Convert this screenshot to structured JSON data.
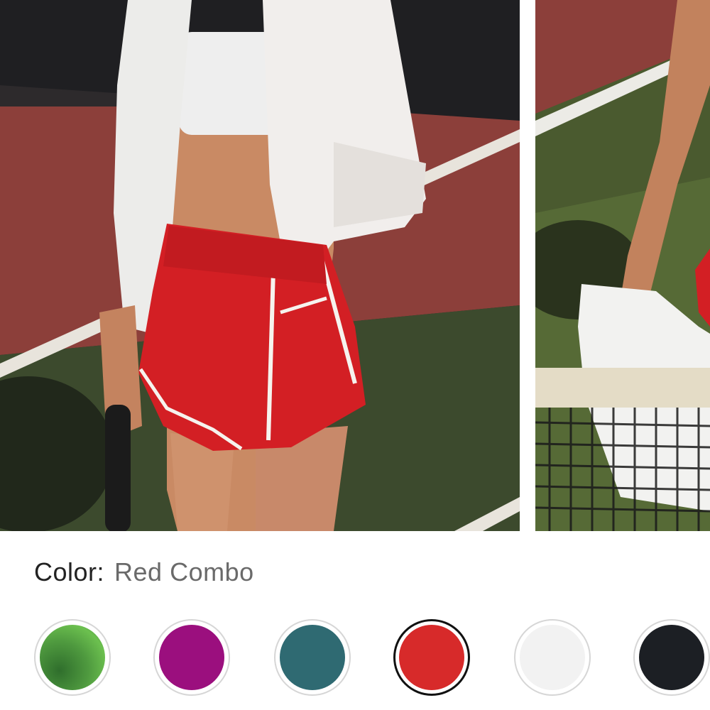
{
  "product": {
    "images": [
      {
        "name": "model-front-photo",
        "alt": ""
      },
      {
        "name": "model-net-photo",
        "alt": ""
      }
    ]
  },
  "color_selector": {
    "label": "Color:",
    "selected_value": "Red Combo",
    "swatches": [
      {
        "color": "#4f9a3f",
        "selected": false
      },
      {
        "color": "#9b0f7e",
        "selected": false
      },
      {
        "color": "#2f6a72",
        "selected": false
      },
      {
        "color": "#d72a2a",
        "selected": true
      },
      {
        "color": "#f2f2f2",
        "selected": false
      },
      {
        "color": "#1c1f24",
        "selected": false
      }
    ]
  }
}
